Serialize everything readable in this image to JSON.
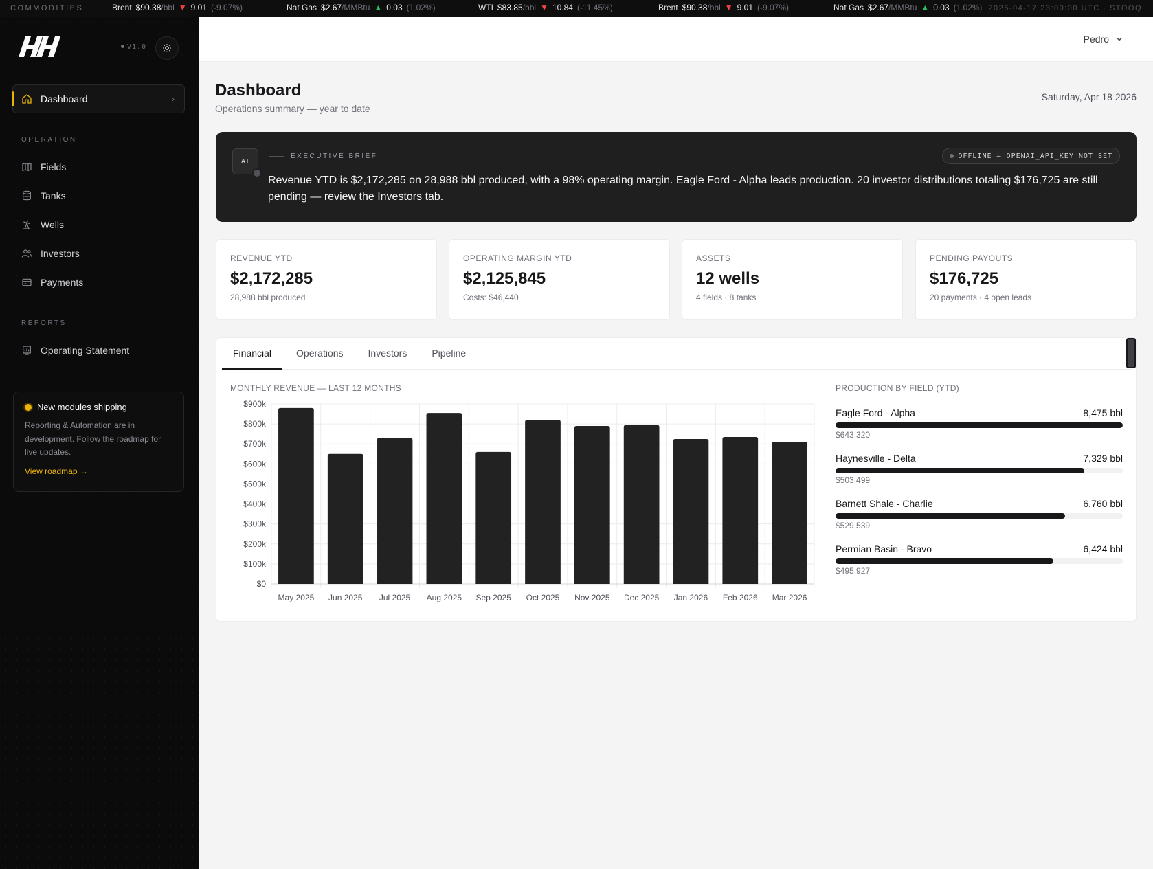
{
  "ticker": {
    "label": "COMMODITIES",
    "items": [
      {
        "name": "Brent",
        "price": "$90.38",
        "unit": "/bbl",
        "dir": "down",
        "change": "9.01",
        "pct": "(-9.07%)"
      },
      {
        "name": "Nat Gas",
        "price": "$2.67",
        "unit": "/MMBtu",
        "dir": "up",
        "change": "0.03",
        "pct": "(1.02%)"
      },
      {
        "name": "WTI",
        "price": "$83.85",
        "unit": "/bbl",
        "dir": "down",
        "change": "10.84",
        "pct": "(-11.45%)"
      },
      {
        "name": "Brent",
        "price": "$90.38",
        "unit": "/bbl",
        "dir": "down",
        "change": "9.01",
        "pct": "(-9.07%)"
      },
      {
        "name": "Nat Gas",
        "price": "$2.67",
        "unit": "/MMBtu",
        "dir": "up",
        "change": "0.03",
        "pct": "(1.02%)"
      }
    ],
    "stamp": "2026-04-17 23:00:00 UTC · STOOQ"
  },
  "sidebar": {
    "version": "V1.0",
    "active": "Dashboard",
    "operation_label": "OPERATION",
    "operation_items": [
      "Fields",
      "Tanks",
      "Wells",
      "Investors",
      "Payments"
    ],
    "reports_label": "REPORTS",
    "reports_items": [
      "Operating Statement"
    ],
    "promo": {
      "title": "New modules shipping",
      "body": "Reporting & Automation are in development. Follow the roadmap for live updates.",
      "link": "View roadmap →"
    }
  },
  "header": {
    "user": "Pedro"
  },
  "page": {
    "title": "Dashboard",
    "subtitle": "Operations summary — year to date",
    "date": "Saturday, Apr 18 2026"
  },
  "brief": {
    "badge": "AI",
    "label": "EXECUTIVE BRIEF",
    "status": "OFFLINE — OPENAI_API_KEY NOT SET",
    "text": "Revenue YTD is $2,172,285 on 28,988 bbl produced, with a 98% operating margin. Eagle Ford - Alpha leads production. 20 investor distributions totaling $176,725 are still pending — review the Investors tab."
  },
  "kpis": [
    {
      "label": "REVENUE YTD",
      "value": "$2,172,285",
      "sub": "28,988 bbl produced"
    },
    {
      "label": "OPERATING MARGIN YTD",
      "value": "$2,125,845",
      "sub": "Costs: $46,440"
    },
    {
      "label": "ASSETS",
      "value": "12 wells",
      "sub": "4 fields · 8 tanks"
    },
    {
      "label": "PENDING PAYOUTS",
      "value": "$176,725",
      "sub": "20 payments · 4 open leads"
    }
  ],
  "tabs": [
    "Financial",
    "Operations",
    "Investors",
    "Pipeline"
  ],
  "chart_data": {
    "type": "bar",
    "title": "MONTHLY REVENUE — LAST 12 MONTHS",
    "categories": [
      "May 2025",
      "Jun 2025",
      "Jul 2025",
      "Aug 2025",
      "Sep 2025",
      "Oct 2025",
      "Nov 2025",
      "Dec 2025",
      "Jan 2026",
      "Feb 2026",
      "Mar 2026"
    ],
    "values": [
      880000,
      650000,
      730000,
      855000,
      660000,
      820000,
      790000,
      795000,
      725000,
      735000,
      710000
    ],
    "ylim": [
      0,
      900000
    ],
    "yticks": [
      "$0",
      "$100k",
      "$200k",
      "$300k",
      "$400k",
      "$500k",
      "$600k",
      "$700k",
      "$800k",
      "$900k"
    ],
    "grid": true,
    "color": "#222222"
  },
  "production": {
    "title": "PRODUCTION BY FIELD (YTD)",
    "fields": [
      {
        "name": "Eagle Ford - Alpha",
        "bbl": "8,475 bbl",
        "revenue": "$643,320",
        "share": 1.0
      },
      {
        "name": "Haynesville - Delta",
        "bbl": "7,329 bbl",
        "revenue": "$503,499",
        "share": 0.865
      },
      {
        "name": "Barnett Shale - Charlie",
        "bbl": "6,760 bbl",
        "revenue": "$529,539",
        "share": 0.798
      },
      {
        "name": "Permian Basin - Bravo",
        "bbl": "6,424 bbl",
        "revenue": "$495,927",
        "share": 0.758
      }
    ]
  }
}
